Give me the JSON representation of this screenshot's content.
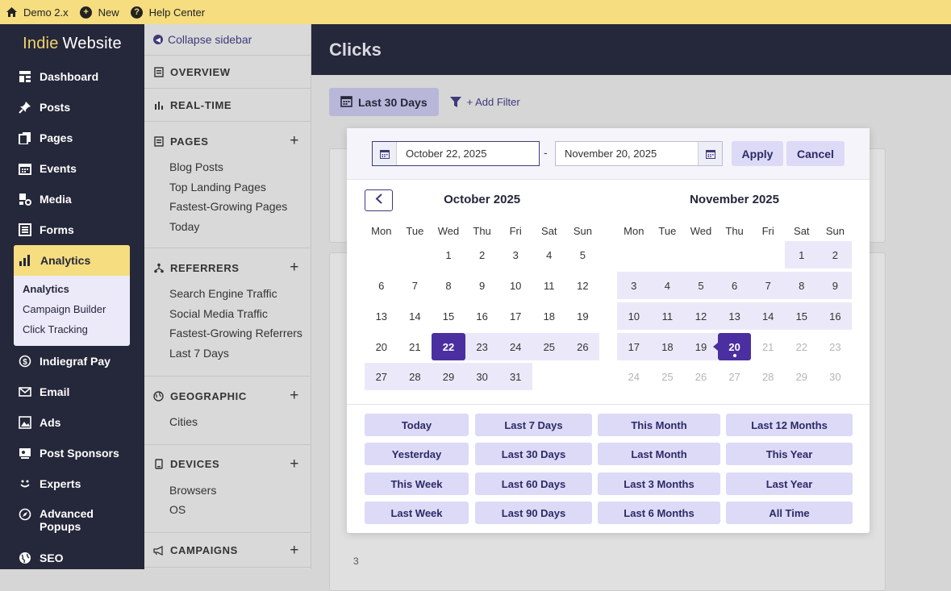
{
  "topbar": {
    "items": [
      {
        "label": "Demo 2.x",
        "icon": "home-icon"
      },
      {
        "label": "New",
        "icon": "plus-circle-icon"
      },
      {
        "label": "Help Center",
        "icon": "help-icon"
      }
    ]
  },
  "brand": {
    "part1": "Indie",
    "part2": "Website"
  },
  "nav": {
    "items": [
      {
        "label": "Dashboard",
        "icon": "dashboard-icon"
      },
      {
        "label": "Posts",
        "icon": "pin-icon"
      },
      {
        "label": "Pages",
        "icon": "pages-icon"
      },
      {
        "label": "Events",
        "icon": "calendar-icon"
      },
      {
        "label": "Media",
        "icon": "media-icon"
      },
      {
        "label": "Forms",
        "icon": "forms-icon"
      },
      {
        "label": "Analytics",
        "icon": "bar-chart-icon"
      },
      {
        "label": "Indiegraf Pay",
        "icon": "dollar-icon"
      },
      {
        "label": "Email",
        "icon": "mail-icon"
      },
      {
        "label": "Ads",
        "icon": "ads-icon"
      },
      {
        "label": "Post Sponsors",
        "icon": "sponsor-icon"
      },
      {
        "label": "Experts",
        "icon": "experts-icon"
      },
      {
        "label": "Advanced Popups",
        "icon": "compass-icon"
      },
      {
        "label": "SEO",
        "icon": "globe-icon"
      }
    ],
    "analytics_sub": [
      "Analytics",
      "Campaign Builder",
      "Click Tracking"
    ]
  },
  "sidebar": {
    "collapse": "Collapse sidebar",
    "sections": [
      {
        "title": "OVERVIEW",
        "links": []
      },
      {
        "title": "REAL-TIME",
        "links": []
      },
      {
        "title": "PAGES",
        "links": [
          "Blog Posts",
          "Top Landing Pages",
          "Fastest-Growing Pages",
          "Today"
        ]
      },
      {
        "title": "REFERRERS",
        "links": [
          "Search Engine Traffic",
          "Social Media Traffic",
          "Fastest-Growing Referrers",
          "Last 7 Days"
        ]
      },
      {
        "title": "GEOGRAPHIC",
        "links": [
          "Cities"
        ]
      },
      {
        "title": "DEVICES",
        "links": [
          "Browsers",
          "OS"
        ]
      },
      {
        "title": "CAMPAIGNS",
        "links": []
      }
    ]
  },
  "main": {
    "title": "Clicks",
    "range_label": "Last 30 Days",
    "filter_label": "+ Add Filter",
    "axis_tick": "3"
  },
  "picker": {
    "start_date": "October 22, 2025",
    "end_date": "November 20, 2025",
    "dash": "-",
    "apply": "Apply",
    "cancel": "Cancel",
    "weekdays": [
      "Mon",
      "Tue",
      "Wed",
      "Thu",
      "Fri",
      "Sat",
      "Sun"
    ],
    "months": [
      {
        "title": "October 2025",
        "weeks": [
          [
            "",
            "",
            "1",
            "2",
            "3",
            "4",
            "5"
          ],
          [
            "6",
            "7",
            "8",
            "9",
            "10",
            "11",
            "12"
          ],
          [
            "13",
            "14",
            "15",
            "16",
            "17",
            "18",
            "19"
          ],
          [
            "20",
            "21",
            "22",
            "23",
            "24",
            "25",
            "26"
          ],
          [
            "27",
            "28",
            "29",
            "30",
            "31",
            "",
            ""
          ]
        ]
      },
      {
        "title": "November 2025",
        "weeks": [
          [
            "",
            "",
            "",
            "",
            "",
            "1",
            "2"
          ],
          [
            "3",
            "4",
            "5",
            "6",
            "7",
            "8",
            "9"
          ],
          [
            "10",
            "11",
            "12",
            "13",
            "14",
            "15",
            "16"
          ],
          [
            "17",
            "18",
            "19",
            "20",
            "21",
            "22",
            "23"
          ],
          [
            "24",
            "25",
            "26",
            "27",
            "28",
            "29",
            "30"
          ]
        ]
      }
    ],
    "selected_start": {
      "month": 0,
      "day": "22"
    },
    "selected_end": {
      "month": 1,
      "day": "20"
    },
    "presets": [
      [
        "Today",
        "Last 7 Days",
        "This Month",
        "Last 12 Months"
      ],
      [
        "Yesterday",
        "Last 30 Days",
        "Last Month",
        "This Year"
      ],
      [
        "This Week",
        "Last 60 Days",
        "Last 3 Months",
        "Last Year"
      ],
      [
        "Last Week",
        "Last 90 Days",
        "Last 6 Months",
        "All Time"
      ]
    ]
  },
  "colors": {
    "topbar": "#f5dd80",
    "nav_bg": "#25273a",
    "selected": "#4b2fa0",
    "range_fill": "#ebe9f9",
    "preset_bg": "#dcdaf7"
  }
}
